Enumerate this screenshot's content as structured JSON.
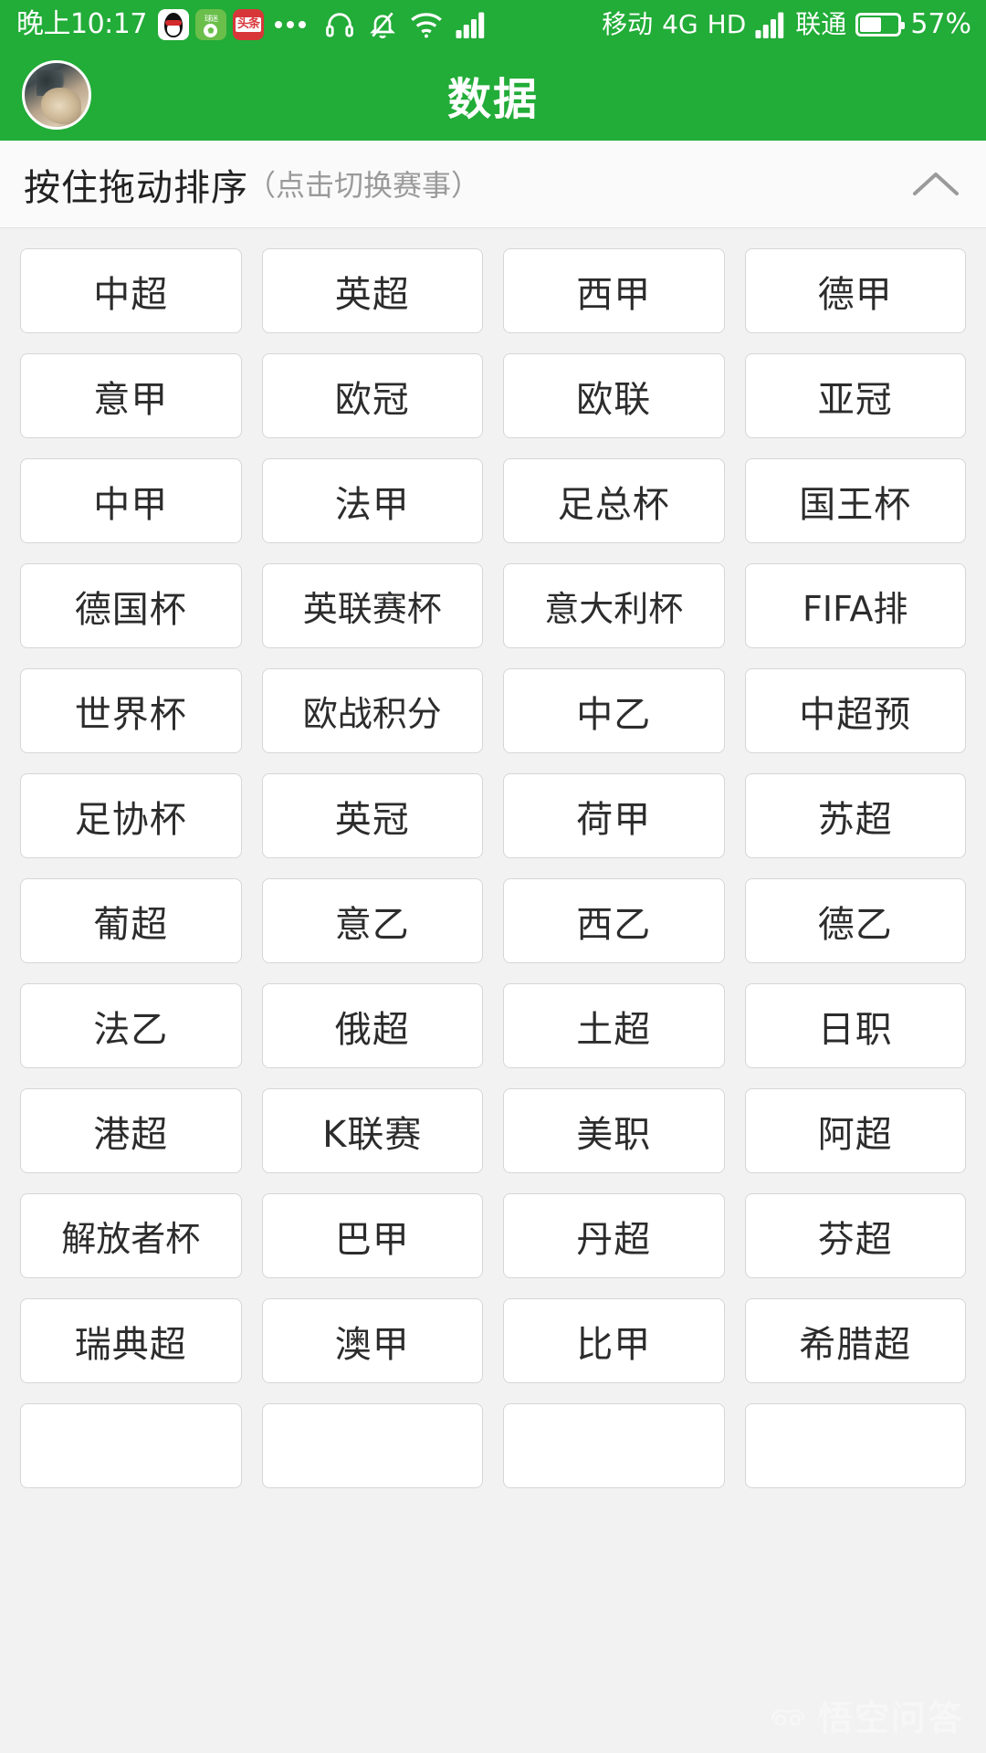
{
  "status_bar": {
    "time": "晚上10:17",
    "app_icons": [
      "qq-icon",
      "football-app-icon",
      "toutiao-icon"
    ],
    "overflow_indicator": "...",
    "icons": [
      "headset-icon",
      "bell-muted-icon",
      "wifi-icon",
      "signal-bars-icon"
    ],
    "carrier_primary": "移动",
    "network_type": "4G",
    "hd_label": "HD",
    "carrier_secondary": "联通",
    "battery_percent": "57%",
    "battery_level": 57,
    "background_color": "#22ac38",
    "text_color": "#ffffff"
  },
  "app_header": {
    "title": "数据",
    "avatar_name": "user-avatar",
    "background_color": "#22ac38",
    "title_color": "#ffffff"
  },
  "section_bar": {
    "title": "按住拖动排序",
    "subtitle": "（点击切换赛事）",
    "collapse_icon": "chevron-up-icon",
    "background_color": "#fafafa",
    "title_color": "#222222",
    "subtitle_color": "#9a9a9a"
  },
  "grid": {
    "columns": 4,
    "cell_background": "#ffffff",
    "cell_border_color": "#d6d6d6",
    "cell_text_color": "#2c2c2c",
    "items": [
      "中超",
      "英超",
      "西甲",
      "德甲",
      "意甲",
      "欧冠",
      "欧联",
      "亚冠",
      "中甲",
      "法甲",
      "足总杯",
      "国王杯",
      "德国杯",
      "英联赛杯",
      "意大利杯",
      "FIFA排",
      "世界杯",
      "欧战积分",
      "中乙",
      "中超预",
      "足协杯",
      "英冠",
      "荷甲",
      "苏超",
      "葡超",
      "意乙",
      "西乙",
      "德乙",
      "法乙",
      "俄超",
      "土超",
      "日职",
      "港超",
      "K联赛",
      "美职",
      "阿超",
      "解放者杯",
      "巴甲",
      "丹超",
      "芬超",
      "瑞典超",
      "澳甲",
      "比甲",
      "希腊超",
      "",
      "",
      "",
      ""
    ]
  },
  "watermark": {
    "text": "悟空问答",
    "icon": "wukong-mask-icon"
  }
}
